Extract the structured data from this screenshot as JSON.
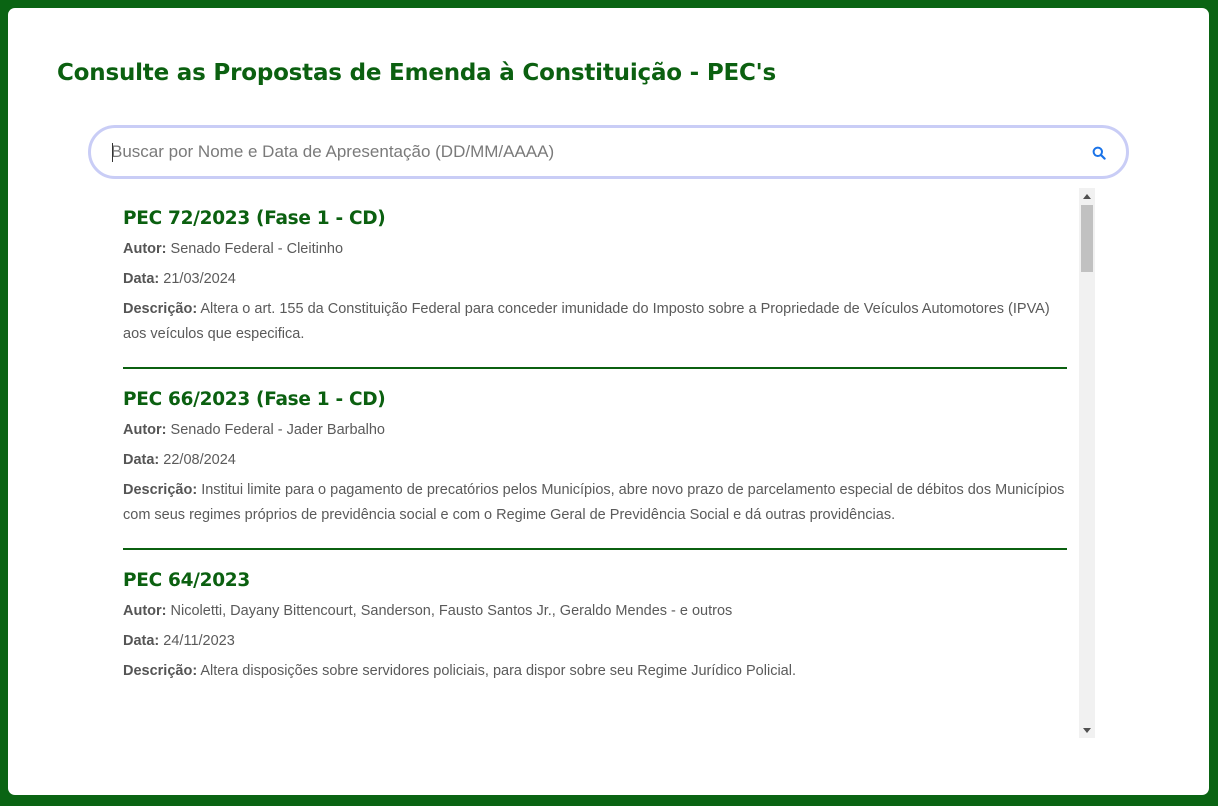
{
  "page": {
    "title": "Consulte as Propostas de Emenda à Constituição - PEC's"
  },
  "search": {
    "placeholder": "Buscar por Nome e Data de Apresentação (DD/MM/AAAA)",
    "value": "",
    "icon": "search-icon"
  },
  "labels": {
    "autor": "Autor:",
    "data": "Data:",
    "descricao": "Descrição:"
  },
  "items": [
    {
      "title": "PEC 72/2023 (Fase 1 - CD)",
      "autor": "Senado Federal - Cleitinho",
      "data": "21/03/2024",
      "descricao": "Altera o art. 155 da Constituição Federal para conceder imunidade do Imposto sobre a Propriedade de Veículos Automotores (IPVA) aos veículos que especifica."
    },
    {
      "title": "PEC 66/2023 (Fase 1 - CD)",
      "autor": "Senado Federal - Jader Barbalho",
      "data": "22/08/2024",
      "descricao": "Institui limite para o pagamento de precatórios pelos Municípios, abre novo prazo de parcelamento especial de débitos dos Municípios com seus regimes próprios de previdência social e com o Regime Geral de Previdência Social e dá outras providências."
    },
    {
      "title": "PEC 64/2023",
      "autor": "Nicoletti, Dayany Bittencourt, Sanderson, Fausto Santos Jr., Geraldo Mendes - e outros",
      "data": "24/11/2023",
      "descricao": "Altera disposições sobre servidores policiais, para dispor sobre seu Regime Jurídico Policial."
    }
  ],
  "colors": {
    "frame": "#0a6413",
    "accent": "#0b6010",
    "search_border": "#c9cdf6",
    "search_icon": "#1a73e8"
  }
}
